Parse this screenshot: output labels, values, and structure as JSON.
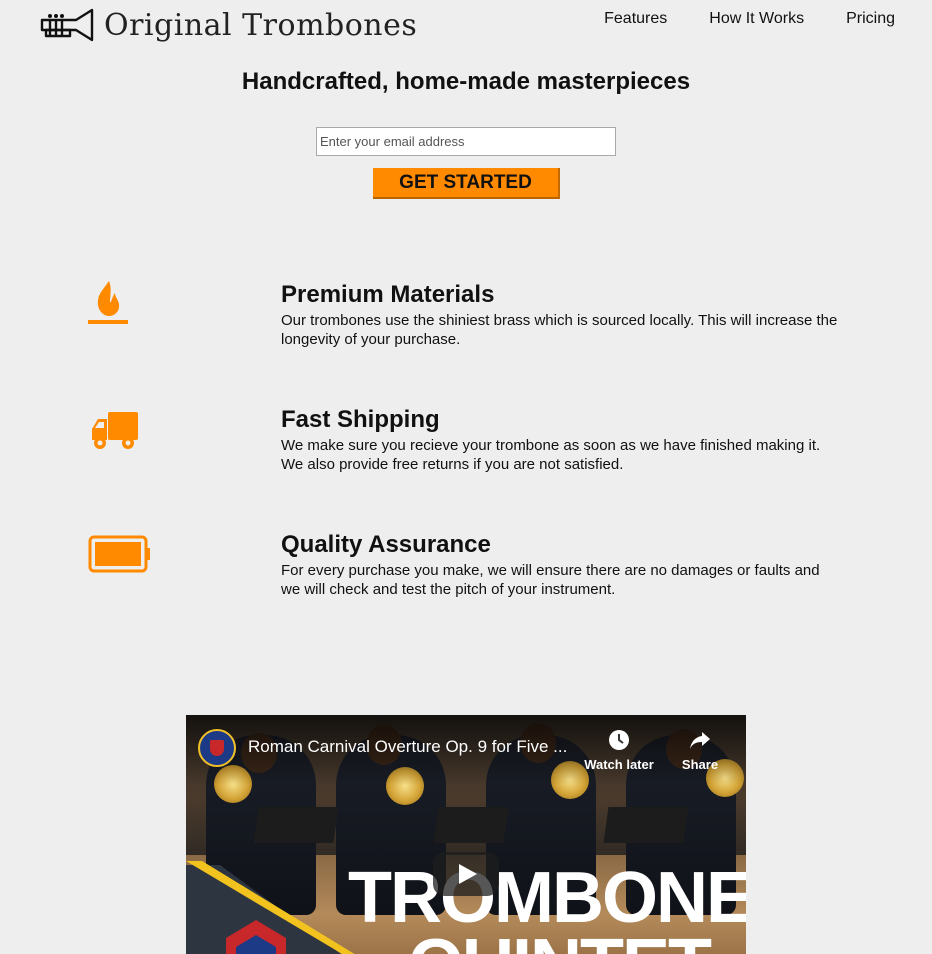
{
  "brand": {
    "name": "Original Trombones",
    "logo_icon": "trumpet-icon"
  },
  "nav": {
    "items": [
      {
        "label": "Features"
      },
      {
        "label": "How It Works"
      },
      {
        "label": "Pricing"
      }
    ]
  },
  "hero": {
    "title": "Handcrafted, home-made masterpieces",
    "email_placeholder": "Enter your email address",
    "email_value": "",
    "cta_label": "GET STARTED"
  },
  "features": [
    {
      "icon": "fire-icon",
      "title": "Premium Materials",
      "text": "Our trombones use the shiniest brass which is sourced locally. This will increase the longevity of your purchase."
    },
    {
      "icon": "truck-icon",
      "title": "Fast Shipping",
      "text": "We make sure you recieve your trombone as soon as we have finished making it. We also provide free returns if you are not satisfied."
    },
    {
      "icon": "battery-full-icon",
      "title": "Quality Assurance",
      "text": "For every purchase you make, we will ensure there are no damages or faults and we will check and test the pitch of your instrument."
    }
  ],
  "video": {
    "title": "Roman Carnival Overture Op. 9 for Five ...",
    "watch_later_label": "Watch later",
    "share_label": "Share",
    "thumbnail_text_line1": "TROMBONE",
    "thumbnail_text_line2": "QUINTET"
  },
  "colors": {
    "accent": "#ff8a00",
    "background": "#eeeeee",
    "text": "#111111"
  }
}
